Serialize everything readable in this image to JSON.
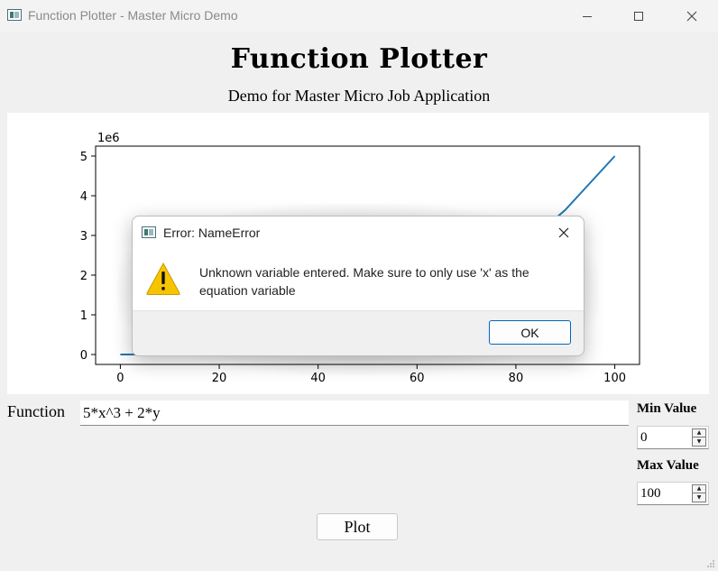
{
  "window": {
    "title": "Function Plotter - Master Micro Demo"
  },
  "header": {
    "title": "Function Plotter",
    "subtitle": "Demo for Master Micro Job Application"
  },
  "chart_data": {
    "type": "line",
    "title": "",
    "xlabel": "",
    "ylabel": "",
    "y_offset_label": "1e6",
    "xlim": [
      -5,
      105
    ],
    "ylim": [
      -250000,
      5250000
    ],
    "x_ticks": [
      0,
      20,
      40,
      60,
      80,
      100
    ],
    "x_tick_labels": [
      "0",
      "20",
      "40",
      "60",
      "80",
      "100"
    ],
    "y_ticks": [
      0,
      1000000,
      2000000,
      3000000,
      4000000,
      5000000
    ],
    "y_tick_labels": [
      "0",
      "1",
      "2",
      "3",
      "4",
      "5"
    ],
    "grid": false,
    "series": [
      {
        "color": "#1f77b4",
        "x": [
          0,
          10,
          20,
          30,
          40,
          50,
          60,
          70,
          80,
          90,
          100
        ],
        "y": [
          0,
          5000,
          40000,
          135000,
          320000,
          625000,
          1080000,
          1715000,
          2560000,
          3645000,
          5000000
        ]
      }
    ]
  },
  "form": {
    "function_label": "Function",
    "function_value": "5*x^3 + 2*y",
    "min_label": "Min Value",
    "min_value": "0",
    "max_label": "Max Value",
    "max_value": "100",
    "plot_label": "Plot"
  },
  "dialog": {
    "title": "Error: NameError",
    "message": "Unknown variable entered. Make sure to only use 'x' as the equation variable",
    "ok_label": "OK"
  },
  "colors": {
    "line": "#1f77b4",
    "warning": "#f7c400",
    "accent": "#0067c0"
  },
  "icons": {
    "app": "app-window-icon",
    "warning": "warning-icon",
    "close": "close-icon"
  }
}
